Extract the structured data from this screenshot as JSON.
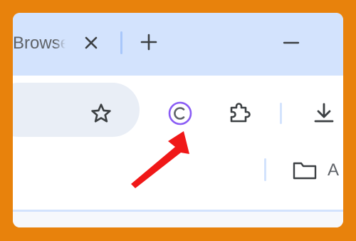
{
  "tab": {
    "title": "Browser",
    "close_icon": "close-icon",
    "new_tab_icon": "plus-icon"
  },
  "window_controls": {
    "minimize_icon": "minimize-icon"
  },
  "toolbar": {
    "bookmark_star_icon": "star-icon",
    "extension_icon": "copyright-icon",
    "extensions_menu_icon": "puzzle-icon",
    "download_icon": "download-icon"
  },
  "bookmarks_bar": {
    "folder_label": "A",
    "folder_icon": "folder-icon"
  },
  "annotation": {
    "type": "red-arrow",
    "color": "#f01818",
    "points_to": "copyright-extension-icon"
  },
  "colors": {
    "frame_border": "#e8820c",
    "tabstrip_bg": "#d3e3fd",
    "omnibox_bg": "#e9eef6",
    "extension_accent": "#8a5cf5",
    "icon": "#3c4043"
  }
}
